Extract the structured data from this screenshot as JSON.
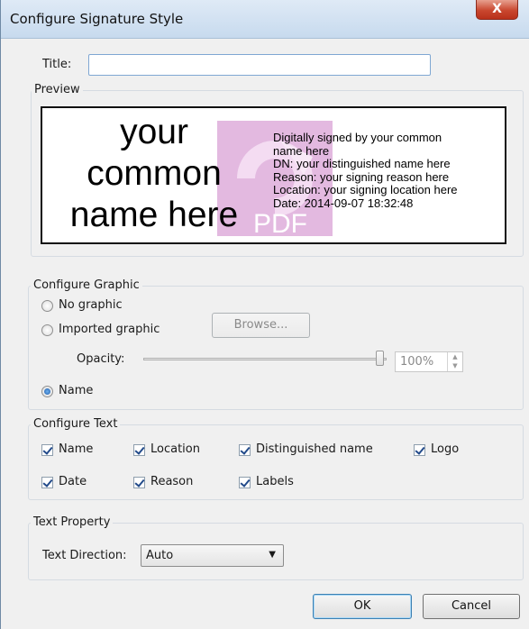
{
  "window": {
    "title": "Configure Signature Style",
    "close_label": "X"
  },
  "title_field": {
    "label": "Title:",
    "value": ""
  },
  "preview": {
    "legend": "Preview",
    "name_lines": [
      "your",
      "common",
      "name here"
    ],
    "detail_lines": [
      "Digitally signed by your common",
      "name here",
      "DN: your distinguished name here",
      "Reason: your signing reason here",
      "Location: your signing location here",
      "Date: 2014-09-07 18:32:48"
    ],
    "watermark_text": "PDF",
    "watermark_color": "#e3b9e0"
  },
  "graphic": {
    "legend": "Configure Graphic",
    "no_graphic": "No graphic",
    "imported_graphic": "Imported graphic",
    "browse_label": "Browse...",
    "opacity_label": "Opacity:",
    "opacity_value": "100%",
    "opacity_level": 1.0,
    "name_option": "Name",
    "selected": "Name"
  },
  "text": {
    "legend": "Configure Text",
    "options": [
      {
        "label": "Name",
        "checked": true
      },
      {
        "label": "Location",
        "checked": true
      },
      {
        "label": "Distinguished name",
        "checked": true
      },
      {
        "label": "Logo",
        "checked": true
      },
      {
        "label": "Date",
        "checked": true
      },
      {
        "label": "Reason",
        "checked": true
      },
      {
        "label": "Labels",
        "checked": true
      }
    ]
  },
  "text_property": {
    "legend": "Text Property",
    "direction_label": "Text Direction:",
    "direction_value": "Auto"
  },
  "buttons": {
    "ok": "OK",
    "cancel": "Cancel"
  }
}
